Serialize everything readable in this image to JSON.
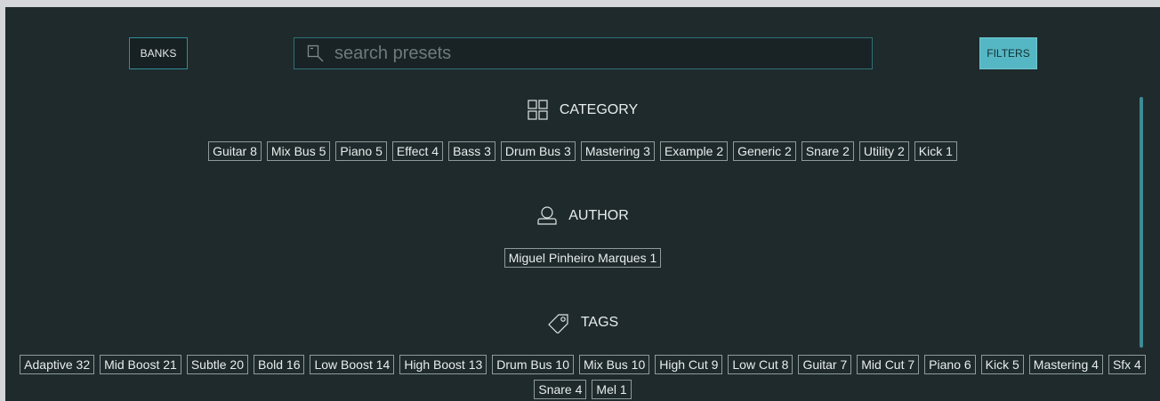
{
  "toolbar": {
    "banks_label": "BANKS",
    "filters_label": "FILTERS",
    "search_placeholder": "search presets"
  },
  "sections": {
    "category": {
      "title": "CATEGORY",
      "chips": [
        "Guitar 8",
        "Mix Bus 5",
        "Piano 5",
        "Effect 4",
        "Bass 3",
        "Drum Bus 3",
        "Mastering 3",
        "Example 2",
        "Generic 2",
        "Snare 2",
        "Utility 2",
        "Kick 1"
      ]
    },
    "author": {
      "title": "AUTHOR",
      "chips": [
        "Miguel Pinheiro Marques 1"
      ]
    },
    "tags": {
      "title": "TAGS",
      "chips": [
        "Adaptive 32",
        "Mid Boost 21",
        "Subtle 20",
        "Bold 16",
        "Low Boost 14",
        "High Boost 13",
        "Drum Bus 10",
        "Mix Bus 10",
        "High Cut 9",
        "Low Cut 8",
        "Guitar 7",
        "Mid Cut 7",
        "Piano 6",
        "Kick 5",
        "Mastering 4",
        "Sfx 4",
        "Snare 4",
        "Mel 1"
      ]
    }
  },
  "colors": {
    "panel_bg": "#1f2a2c",
    "accent": "#56b7c4",
    "chip_border": "#8f9a9b"
  },
  "icons": {
    "category": "grid-icon",
    "author": "user-icon",
    "tags": "tag-icon",
    "search": "search-icon"
  }
}
